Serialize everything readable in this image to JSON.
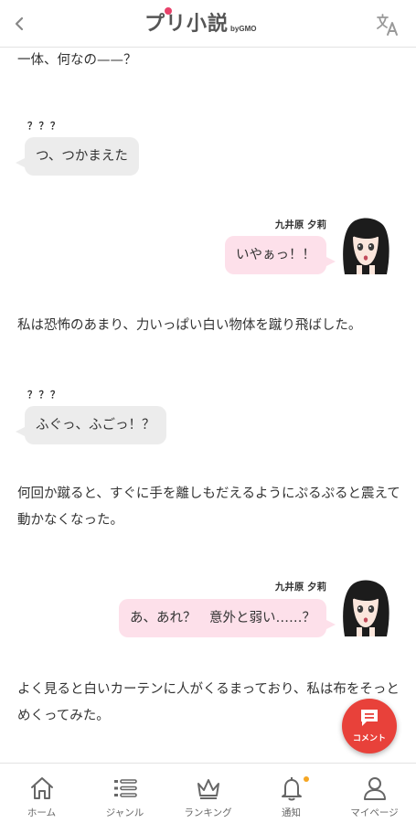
{
  "header": {
    "logo_main": "プリ小説",
    "logo_sub": "byGMO"
  },
  "story": {
    "line1": "一体、何なの——？",
    "speaker_unknown": "？？？",
    "bubble1": "つ、つかまえた",
    "speaker_yuri": "九井原 夕莉",
    "bubble2": "いやぁっ！！",
    "line2": "私は恐怖のあまり、力いっぱい白い物体を蹴り飛ばした。",
    "bubble3": "ふぐっ、ふごっ！？",
    "line3": "何回か蹴ると、すぐに手を離しもだえるようにぷるぷると震えて動かなくなった。",
    "bubble4": "あ、あれ？　意外と弱い……？",
    "line4": "よく見ると白いカーテンに人がくるまっており、私は布をそっとめくってみた。"
  },
  "fab": {
    "label": "コメント"
  },
  "nav": {
    "home": "ホーム",
    "genre": "ジャンル",
    "ranking": "ランキング",
    "notify": "通知",
    "mypage": "マイページ"
  },
  "colors": {
    "accent": "#e8413a",
    "bubble_pink": "#fde0ea",
    "bubble_gray": "#ececec",
    "notify_dot": "#f5a623"
  }
}
